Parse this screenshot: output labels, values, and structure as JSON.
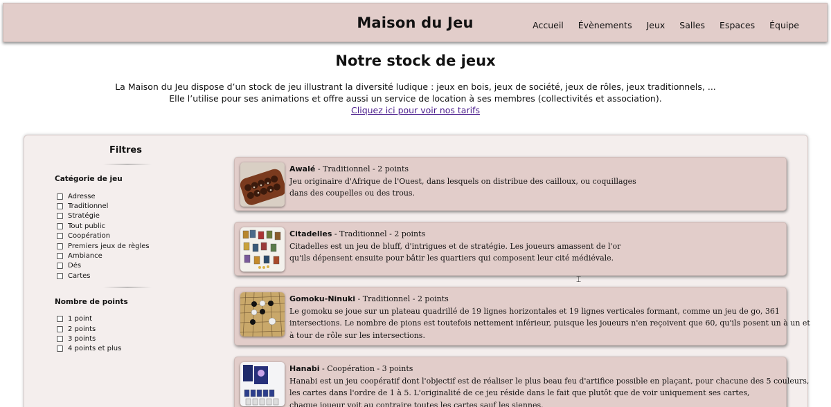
{
  "header": {
    "brand": "Maison du Jeu",
    "nav": [
      "Accueil",
      "Évènements",
      "Jeux",
      "Salles",
      "Espaces",
      "Équipe"
    ]
  },
  "intro": {
    "title": "Notre stock de jeux",
    "line1": "La Maison du Jeu dispose d’un stock de jeu illustrant la diversité ludique : jeux en bois, jeux de société, jeux de rôles, jeux traditionnels, ...",
    "line2": "Elle l’utilise pour ses animations et offre aussi un service de location à ses membres (collectivités et association).",
    "link": "Cliquez ici pour voir nos tarifs"
  },
  "filters": {
    "title": "Filtres",
    "category_title": "Catégorie de jeu",
    "categories": [
      "Adresse",
      "Traditionnel",
      "Stratégie",
      "Tout public",
      "Coopération",
      "Premiers jeux de règles",
      "Ambiance",
      "Dés",
      "Cartes"
    ],
    "points_title": "Nombre de points",
    "points": [
      "1 point",
      "2 points",
      "3 points",
      "4 points et plus"
    ]
  },
  "games": [
    {
      "name": "Awalé",
      "meta": " - Traditionnel - 2 points",
      "desc": [
        "Jeu originaire d'Afrique de l'Ouest, dans lesquels on distribue des cailloux, ou coquillages",
        "dans des coupelles ou des trous."
      ]
    },
    {
      "name": "Citadelles",
      "meta": " - Traditionnel - 2 points",
      "desc": [
        "Citadelles est un jeu de bluff, d'intrigues et de stratégie. Les joueurs amassent de l'or",
        "qu'ils dépensent ensuite pour bâtir les quartiers qui composent leur cité médiévale."
      ]
    },
    {
      "name": "Gomoku-Ninuki",
      "meta": " - Traditionnel - 2 points",
      "desc": [
        "Le gomoku se joue sur un plateau quadrillé de 19 lignes horizontales et 19 lignes verticales formant, comme un jeu de go, 361",
        "intersections. Le nombre de pions est toutefois nettement inférieur, puisque les joueurs n'en reçoivent que 60, qu'ils posent un à un et",
        "à tour de rôle sur les intersections."
      ]
    },
    {
      "name": "Hanabi",
      "meta": " - Coopération - 3 points",
      "desc": [
        "Hanabi est un jeu coopératif dont l'objectif est de réaliser le plus beau feu d'artifice possible en plaçant, pour chacune des 5 couleurs,",
        "les cartes dans l'ordre de 1 à 5. L'originalité de ce jeu réside dans le fait que plutôt que de voir uniquement ses cartes,",
        "chaque joueur voit au contraire toutes les cartes sauf les siennes."
      ]
    }
  ]
}
